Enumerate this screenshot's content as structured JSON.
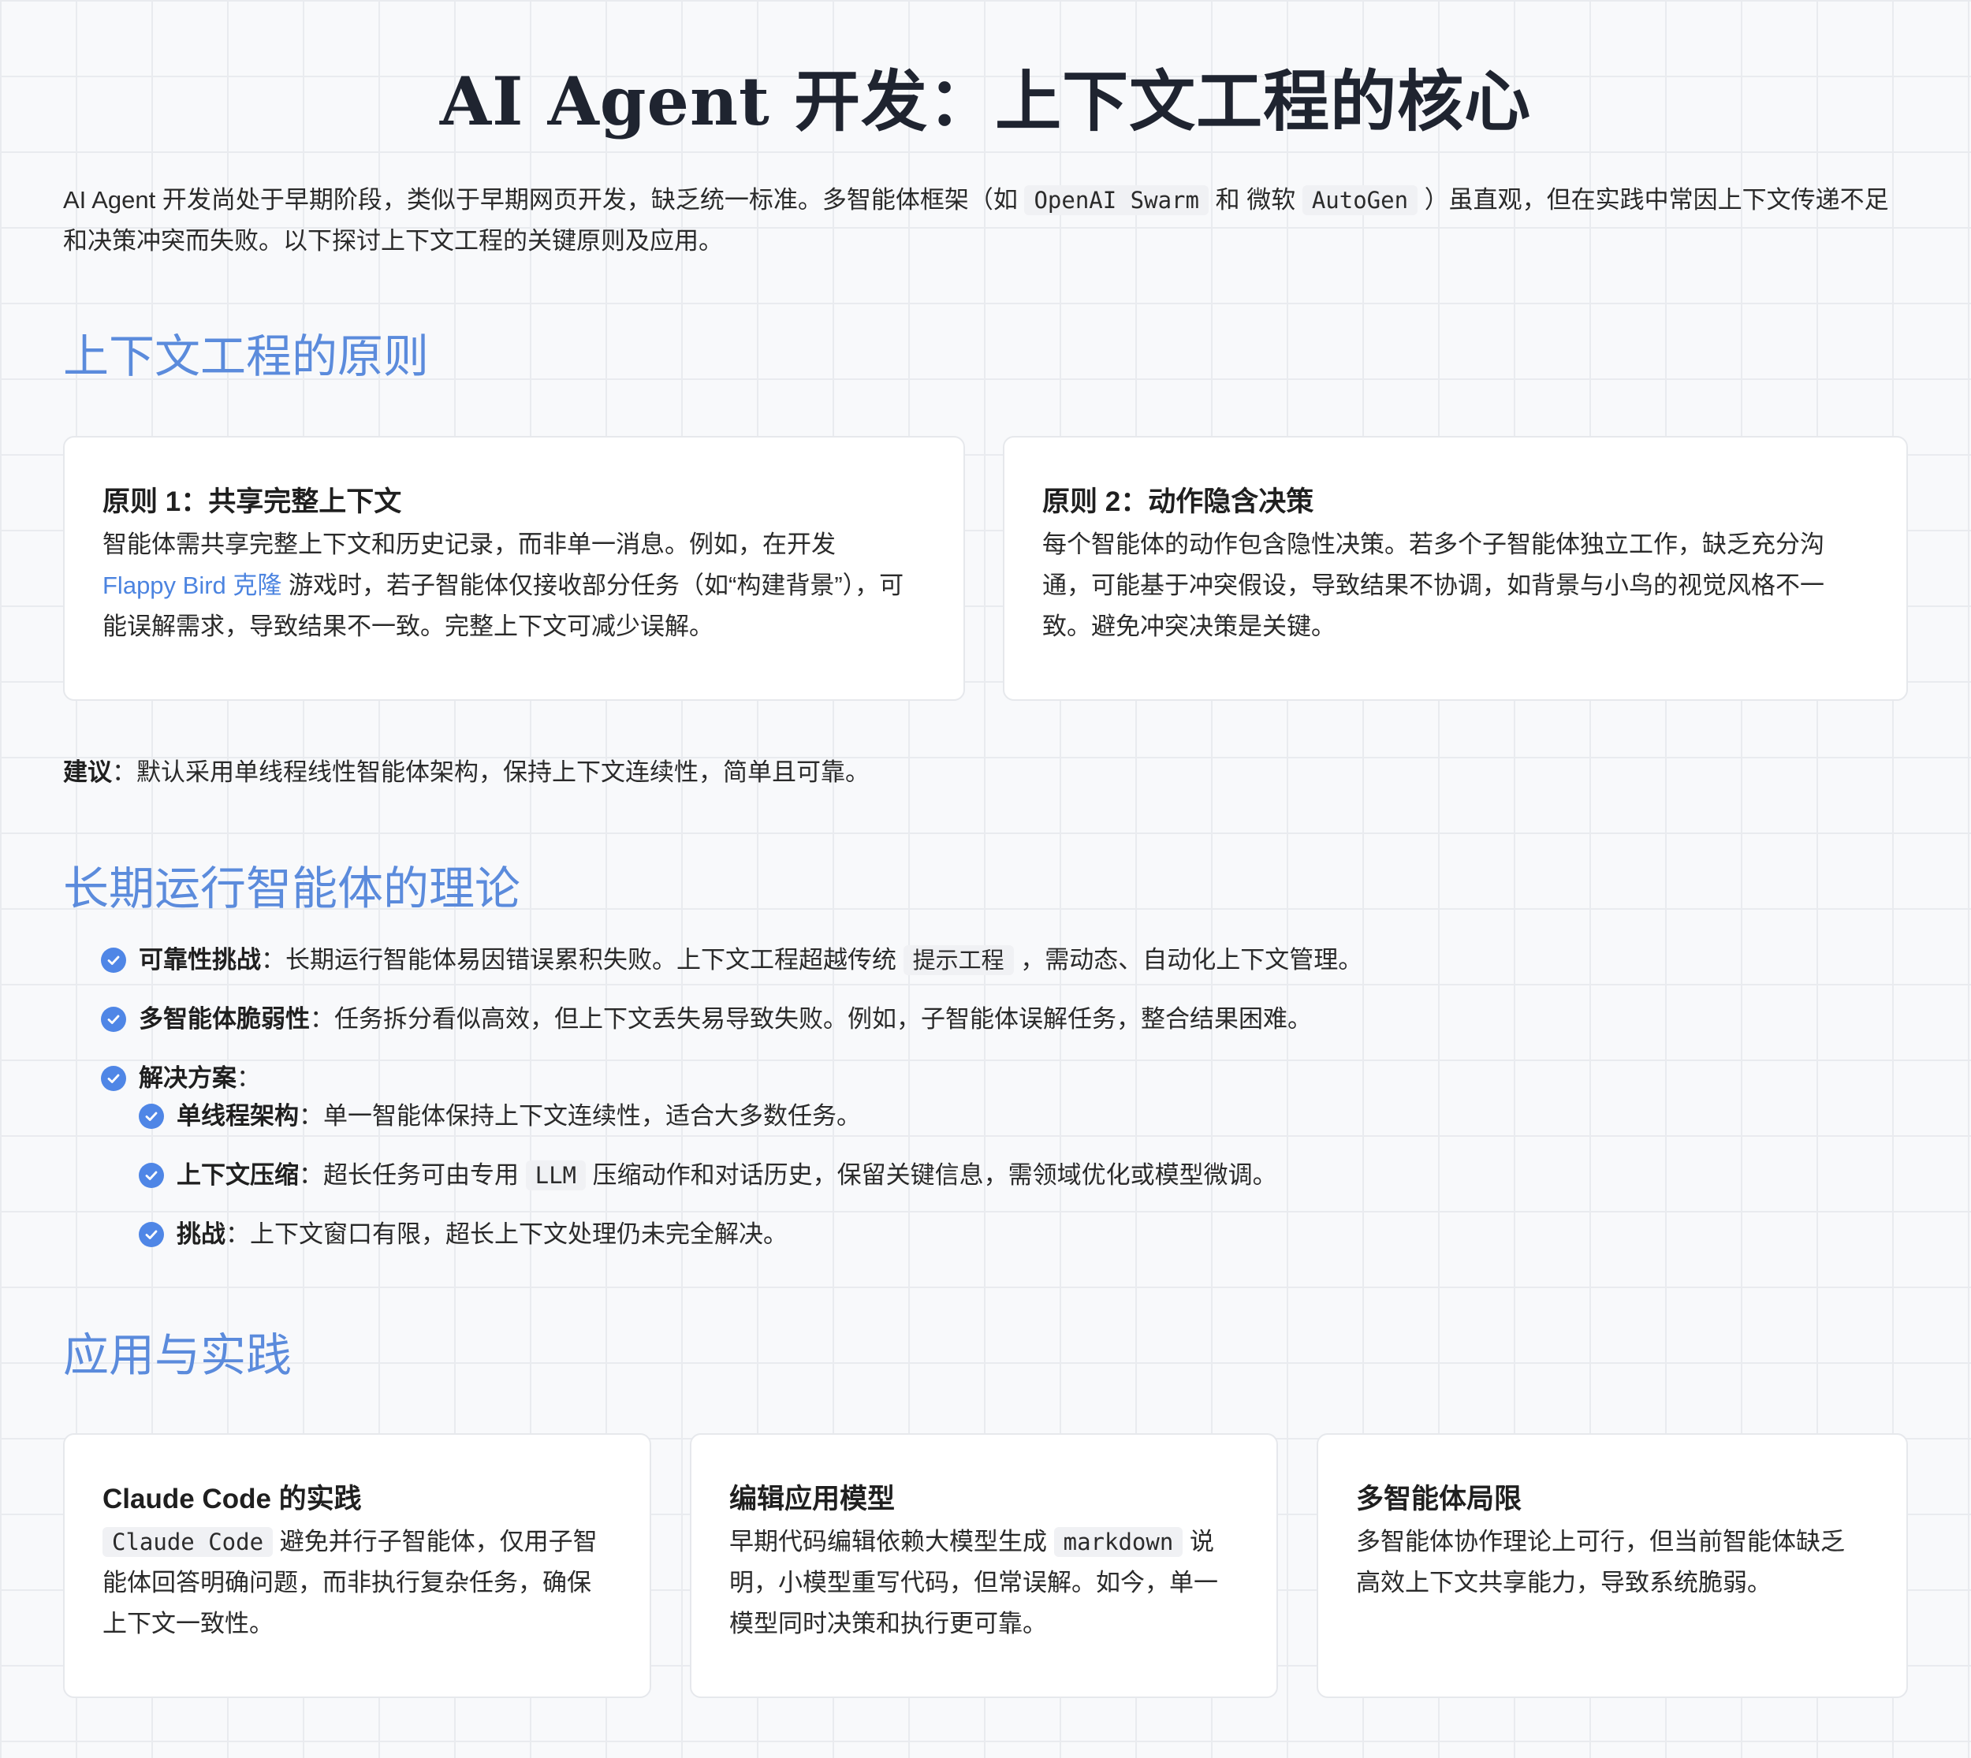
{
  "title": "AI Agent 开发：上下文工程的核心",
  "intro": {
    "part1": "AI Agent 开发尚处于早期阶段，类似于早期网页开发，缺乏统一标准。多智能体框架（如",
    "code1": "OpenAI Swarm",
    "part2": "和",
    "part3": "微软",
    "code2": "AutoGen",
    "part4": "）虽直观，但在实践中常因上下文传递不足和决策冲突而失败。以下探讨上下文工程的关键原则及应用。"
  },
  "section1": {
    "title": "上下文工程的原则",
    "card1": {
      "title": "原则 1：共享完整上下文",
      "body1": "智能体需共享完整上下文和历史记录，而非单一消息。例如，在开发",
      "link": "Flappy Bird 克隆",
      "body2": "游戏时，若子智能体仅接收部分任务（如“构建背景”），可能误解需求，导致结果不一致。完整上下文可减少误解。"
    },
    "card2": {
      "title": "原则 2：动作隐含决策",
      "body": "每个智能体的动作包含隐性决策。若多个子智能体独立工作，缺乏充分沟通，可能基于冲突假设，导致结果不协调，如背景与小鸟的视觉风格不一致。避免冲突决策是关键。"
    },
    "advice_label": "建议",
    "advice_text": "：默认采用单线程线性智能体架构，保持上下文连续性，简单且可靠。"
  },
  "section2": {
    "title": "长期运行智能体的理论",
    "items": [
      {
        "label": "可靠性挑战",
        "text1": "：长期运行智能体易因错误累积失败。上下文工程超越传统",
        "code": "提示工程",
        "text2": "，需动态、自动化上下文管理。"
      },
      {
        "label": "多智能体脆弱性",
        "text": "：任务拆分看似高效，但上下文丢失易导致失败。例如，子智能体误解任务，整合结果困难。"
      },
      {
        "label": "解决方案",
        "text": "："
      }
    ],
    "subitems": [
      {
        "label": "单线程架构",
        "text": "：单一智能体保持上下文连续性，适合大多数任务。"
      },
      {
        "label": "上下文压缩",
        "text1": "：超长任务可由专用",
        "code": "LLM",
        "text2": "压缩动作和对话历史，保留关键信息，需领域优化或模型微调。"
      },
      {
        "label": "挑战",
        "text": "：上下文窗口有限，超长上下文处理仍未完全解决。"
      }
    ]
  },
  "section3": {
    "title": "应用与实践",
    "card1": {
      "title": "Claude Code 的实践",
      "code": "Claude Code",
      "body": "避免并行子智能体，仅用子智能体回答明确问题，而非执行复杂任务，确保上下文一致性。"
    },
    "card2": {
      "title": "编辑应用模型",
      "body1": "早期代码编辑依赖大模型生成",
      "code": "markdown",
      "body2": "说明，小模型重写代码，但常误解。如今，单一模型同时决策和执行更可靠。"
    },
    "card3": {
      "title": "多智能体局限",
      "body": "多智能体协作理论上可行，但当前智能体缺乏高效上下文共享能力，导致系统脆弱。"
    }
  },
  "colors": {
    "accent": "#5b8bdc",
    "check": "#4f86e6",
    "link": "#4c84e0"
  }
}
